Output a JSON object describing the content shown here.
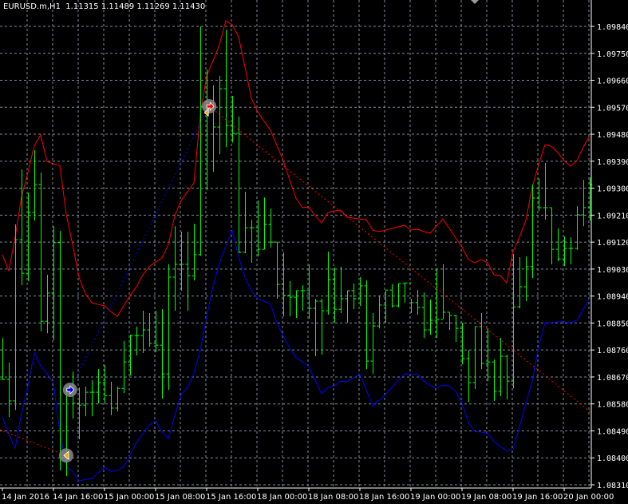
{
  "header": {
    "symbol": "EURUSD.m,H1",
    "ohlc": "1.11315 1.11489 1.11269 1.11430"
  },
  "colors": {
    "background": "#000000",
    "bars": "#00ff00",
    "grid": "#7f8c9c",
    "upper_band": "#ff0000",
    "lower_band": "#0000ff",
    "axis": "#ffffff"
  },
  "chart_data": {
    "type": "bar",
    "title": "EURUSD.m,H1",
    "ylim": [
      1.0831,
      1.0984
    ],
    "grid": true,
    "price_labels": [
      "1.09840",
      "1.09750",
      "1.09660",
      "1.09570",
      "1.09480",
      "1.09390",
      "1.09300",
      "1.09210",
      "1.09120",
      "1.09030",
      "1.08940",
      "1.08850",
      "1.08760",
      "1.08670",
      "1.08580",
      "1.08490",
      "1.08400",
      "1.08310"
    ],
    "time_labels": [
      "14 Jan 2016",
      "14 Jan 16:00",
      "15 Jan 00:00",
      "15 Jan 08:00",
      "15 Jan 16:00",
      "18 Jan 00:00",
      "18 Jan 08:00",
      "18 Jan 16:00",
      "19 Jan 00:00",
      "19 Jan 08:00",
      "19 Jan 16:00",
      "20 Jan 00:00"
    ],
    "bars_hlc": [
      [
        1.088,
        1.08662,
        1.08662
      ],
      [
        1.08718,
        1.08536,
        1.0859
      ],
      [
        1.09179,
        1.0856,
        1.09128
      ],
      [
        1.09363,
        1.08976,
        1.09016
      ],
      [
        1.09285,
        1.0899,
        1.09219
      ],
      [
        1.09427,
        1.09192,
        1.09312
      ],
      [
        1.09352,
        1.08822,
        1.08856
      ],
      [
        1.09011,
        1.08816,
        1.0895
      ],
      [
        1.09173,
        1.08792,
        1.09118
      ],
      [
        1.09157,
        1.08358,
        1.084
      ],
      [
        1.0863,
        1.08339,
        1.0863
      ],
      [
        1.08688,
        1.08531,
        1.08582
      ],
      [
        1.08635,
        1.08462,
        1.08576
      ],
      [
        1.08638,
        1.08539,
        1.08619
      ],
      [
        1.08659,
        1.08539,
        1.08619
      ],
      [
        1.08696,
        1.08582,
        1.08651
      ],
      [
        1.0871,
        1.08582,
        1.08608
      ],
      [
        1.08654,
        1.08542,
        1.08566
      ],
      [
        1.08638,
        1.08555,
        1.08632
      ],
      [
        1.0879,
        1.08616,
        1.0872
      ],
      [
        1.08811,
        1.08675,
        1.08808
      ],
      [
        1.08838,
        1.08742,
        1.08808
      ],
      [
        1.08891,
        1.0875,
        1.08827
      ],
      [
        1.08883,
        1.08771,
        1.08782
      ],
      [
        1.08891,
        1.08752,
        1.08776
      ],
      [
        1.08896,
        1.08598,
        1.0868
      ],
      [
        1.09046,
        1.08627,
        1.09003
      ],
      [
        1.09173,
        1.08891,
        1.09046
      ],
      [
        1.09155,
        1.08958,
        1.09046
      ],
      [
        1.09155,
        1.08891,
        1.09008
      ],
      [
        1.09181,
        1.08992,
        1.09078
      ],
      [
        1.0984,
        1.09075,
        1.09573
      ],
      [
        1.09696,
        1.09293,
        1.09573
      ],
      [
        1.09643,
        1.09355,
        1.09504
      ],
      [
        1.09675,
        1.09413,
        1.09632
      ],
      [
        1.09829,
        1.09437,
        1.09509
      ],
      [
        1.09608,
        1.09453,
        1.09483
      ],
      [
        1.09539,
        1.09083,
        1.09086
      ],
      [
        1.09288,
        1.09083,
        1.09168
      ],
      [
        1.09195,
        1.09051,
        1.09168
      ],
      [
        1.09259,
        1.09072,
        1.09096
      ],
      [
        1.09269,
        1.09096,
        1.09179
      ],
      [
        1.09232,
        1.09102,
        1.0912
      ],
      [
        1.0912,
        1.08931,
        1.08979
      ],
      [
        1.09086,
        1.08872,
        1.08942
      ],
      [
        1.0899,
        1.08872,
        1.08936
      ],
      [
        1.08958,
        1.08867,
        1.08958
      ],
      [
        1.08976,
        1.08891,
        1.08958
      ],
      [
        1.09046,
        1.08864,
        1.08899
      ],
      [
        1.08931,
        1.08739,
        1.08923
      ],
      [
        1.08931,
        1.08744,
        1.08891
      ],
      [
        1.09088,
        1.08878,
        1.08995
      ],
      [
        1.09035,
        1.08851,
        1.08896
      ],
      [
        1.09038,
        1.08883,
        1.08931
      ],
      [
        1.08958,
        1.08851,
        1.08958
      ],
      [
        1.08982,
        1.08896,
        1.08931
      ],
      [
        1.09003,
        1.08907,
        1.08974
      ],
      [
        1.08992,
        1.08696,
        1.08723
      ],
      [
        1.08883,
        1.0868,
        1.0884
      ],
      [
        1.08942,
        1.08832,
        1.0891
      ],
      [
        1.0896,
        1.08851,
        1.0896
      ],
      [
        1.08979,
        1.08902,
        1.08907
      ],
      [
        1.08982,
        1.08902,
        1.08982
      ],
      [
        1.08984,
        1.08918,
        1.08984
      ],
      [
        1.08931,
        1.08883,
        1.08918
      ],
      [
        1.0896,
        1.08878,
        1.08902
      ],
      [
        1.08952,
        1.088,
        1.08827
      ],
      [
        1.08928,
        1.08811,
        1.08859
      ],
      [
        1.09032,
        1.088,
        1.08862
      ],
      [
        1.09046,
        1.08864,
        1.08886
      ],
      [
        1.08886,
        1.08827,
        1.08875
      ],
      [
        1.08878,
        1.08787,
        1.08832
      ],
      [
        1.08851,
        1.08712,
        1.08731
      ],
      [
        1.0876,
        1.08587,
        1.08651
      ],
      [
        1.08838,
        1.0863,
        1.08838
      ],
      [
        1.08883,
        1.08696,
        1.08715
      ],
      [
        1.08832,
        1.08656,
        1.0872
      ],
      [
        1.08728,
        1.0859,
        1.08622
      ],
      [
        1.088,
        1.08606,
        1.08739
      ],
      [
        1.08744,
        1.08595,
        1.08656
      ],
      [
        1.0908,
        1.08632,
        1.08904
      ],
      [
        1.0907,
        1.08899,
        1.08971
      ],
      [
        1.09072,
        1.08923,
        1.09038
      ],
      [
        1.09312,
        1.09,
        1.09267
      ],
      [
        1.09333,
        1.09224,
        1.09235
      ],
      [
        1.09384,
        1.09195,
        1.09235
      ],
      [
        1.09235,
        1.09046,
        1.09096
      ],
      [
        1.09166,
        1.09056,
        1.09064
      ],
      [
        1.09139,
        1.0904,
        1.09099
      ],
      [
        1.09136,
        1.09046,
        1.09099
      ],
      [
        1.0924,
        1.09094,
        1.09211
      ],
      [
        1.09328,
        1.09173,
        1.09235
      ],
      [
        1.09336,
        1.09192,
        1.09312
      ]
    ],
    "upper_band": [
      1.09078,
      1.09024,
      1.09136,
      1.09272,
      1.09352,
      1.09443,
      1.09477,
      1.09389,
      1.09381,
      1.09376,
      1.09213,
      1.09112,
      1.09003,
      1.08947,
      1.08918,
      1.08912,
      1.08907,
      1.08888,
      1.08872,
      1.08907,
      1.08942,
      1.08971,
      1.09011,
      1.09038,
      1.09054,
      1.09067,
      1.09112,
      1.09208,
      1.09259,
      1.09288,
      1.09317,
      1.09544,
      1.09675,
      1.09725,
      1.09779,
      1.09859,
      1.09845,
      1.09805,
      1.09704,
      1.096,
      1.09555,
      1.09523,
      1.09493,
      1.09443,
      1.09392,
      1.09328,
      1.09267,
      1.09235,
      1.09237,
      1.09208,
      1.09184,
      1.09219,
      1.09224,
      1.09227,
      1.09203,
      1.092,
      1.09197,
      1.09195,
      1.0916,
      1.09155,
      1.0916,
      1.09166,
      1.09171,
      1.09176,
      1.0916,
      1.09163,
      1.09155,
      1.0915,
      1.09173,
      1.09197,
      1.09166,
      1.09134,
      1.09104,
      1.09062,
      1.09051,
      1.09062,
      1.09051,
      1.09011,
      1.09008,
      1.08984,
      1.09088,
      1.09136,
      1.09192,
      1.09304,
      1.09379,
      1.09445,
      1.0944,
      1.09419,
      1.09392,
      1.09373,
      1.09392,
      1.09437,
      1.09475
    ],
    "lower_band": [
      1.08536,
      1.0848,
      1.08432,
      1.0855,
      1.0864,
      1.0875,
      1.08707,
      1.0868,
      1.08648,
      1.08486,
      1.08371,
      1.08355,
      1.08323,
      1.08328,
      1.08331,
      1.0835,
      1.08368,
      1.08355,
      1.08358,
      1.08371,
      1.08408,
      1.08451,
      1.0848,
      1.0851,
      1.08523,
      1.08486,
      1.08464,
      1.08542,
      1.08611,
      1.08635,
      1.08683,
      1.0876,
      1.08872,
      1.08971,
      1.09051,
      1.09107,
      1.0916,
      1.09072,
      1.09003,
      1.08958,
      1.08931,
      1.08923,
      1.08912,
      1.08851,
      1.08806,
      1.08766,
      1.08734,
      1.0872,
      1.08704,
      1.08659,
      1.08614,
      1.08635,
      1.0864,
      1.08656,
      1.08654,
      1.08667,
      1.0868,
      1.08627,
      1.08574,
      1.08592,
      1.08611,
      1.08635,
      1.08659,
      1.0868,
      1.0868,
      1.0868,
      1.08656,
      1.08643,
      1.08632,
      1.08643,
      1.0864,
      1.08622,
      1.08582,
      1.08518,
      1.08488,
      1.08486,
      1.08483,
      1.08454,
      1.08438,
      1.08424,
      1.08427,
      1.08504,
      1.08582,
      1.08656,
      1.08771,
      1.08851,
      1.08851,
      1.08854,
      1.08854,
      1.08851,
      1.08859,
      1.08896,
      1.08931
    ],
    "trade_lines": [
      {
        "color": "#ff0000",
        "from": [
          -0.4,
          1.08494
        ],
        "to": [
          10,
          1.08408
        ]
      },
      {
        "color": "#0000ff",
        "from": [
          10.6,
          1.08627
        ],
        "to": [
          32.4,
          1.09579
        ]
      },
      {
        "color": "#ff0000",
        "from": [
          32.4,
          1.09573
        ],
        "to": [
          92.3,
          1.0855
        ]
      }
    ],
    "markers": [
      {
        "type": "buy-arrow",
        "bar": 10.6,
        "price": 1.08627
      },
      {
        "type": "close-left-arrow",
        "bar": 10,
        "price": 1.08408
      },
      {
        "type": "sell-arrow",
        "bar": 32.4,
        "price": 1.09573
      }
    ]
  }
}
